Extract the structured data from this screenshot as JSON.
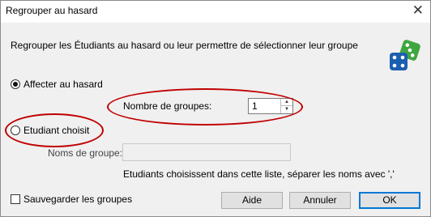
{
  "window": {
    "title": "Regrouper au hasard",
    "close_glyph": "✕"
  },
  "description": "Regrouper les Étudiants au hasard ou leur permettre de sélectionner leur groupe",
  "icon": {
    "name": "dice-icon",
    "colors": {
      "green": "#3fa63f",
      "blue": "#1c5fb0"
    }
  },
  "options": {
    "random": {
      "label": "Affecter au hasard",
      "checked": true
    },
    "student_choice": {
      "label": "Etudiant choisit",
      "checked": false
    }
  },
  "group_count": {
    "label": "Nombre de groupes:",
    "value": "1"
  },
  "group_names": {
    "label": "Noms de groupe:",
    "value": "",
    "hint": "Etudiants choisissent dans cette liste, séparer les noms avec ','"
  },
  "save_groups": {
    "label": "Sauvegarder les groupes",
    "checked": false
  },
  "buttons": {
    "help": "Aide",
    "cancel": "Annuler",
    "ok": "OK"
  },
  "annotation_color": "#c00000"
}
